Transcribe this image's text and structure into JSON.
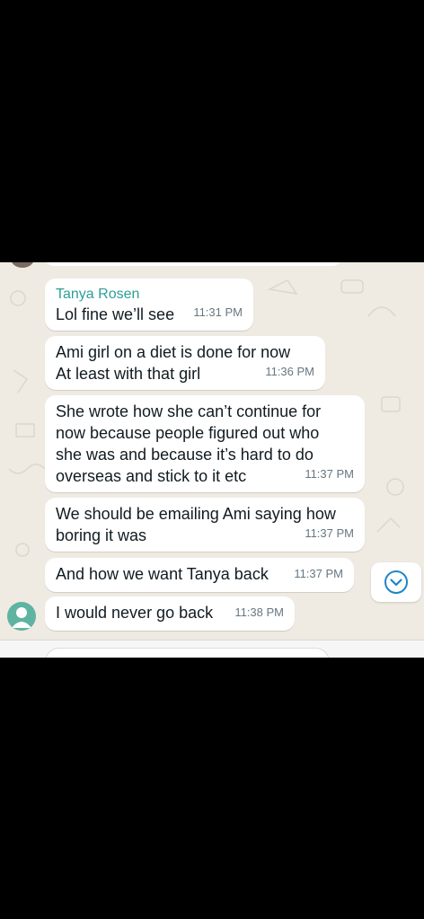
{
  "messages": [
    {
      "sender": "Tanya Rosen",
      "text": "Lol fine we’ll see",
      "time": "11:31 PM"
    },
    {
      "text": "Ami girl on a diet is done for now\nAt least with that girl",
      "time": "11:36 PM"
    },
    {
      "text": "She wrote how she can’t continue for\nnow because people figured out who\nshe was and because it’s hard to do\noverseas and stick to it etc",
      "time": "11:37 PM"
    },
    {
      "text": "We should be emailing Ami saying how\nboring it was",
      "time": "11:37 PM"
    },
    {
      "text": "And how we want Tanya back",
      "time": "11:37 PM"
    },
    {
      "text": "I would never go back",
      "time": "11:38 PM"
    }
  ],
  "icons": {
    "scroll_down": "chevron-down-circle-icon",
    "avatar": "person-avatar-icon"
  },
  "colors": {
    "chat_background": "#efeae2",
    "bubble": "#ffffff",
    "sender_name": "#2e9e95",
    "timestamp": "#667781",
    "scroll_button_icon": "#1d86c9"
  }
}
